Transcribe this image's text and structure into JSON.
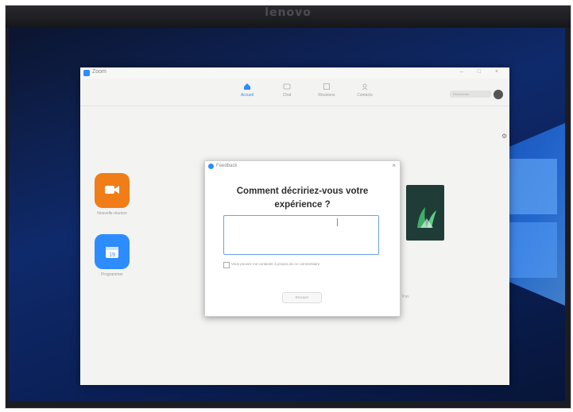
{
  "bezel": {
    "brand": "lenovo"
  },
  "app": {
    "title": "Zoom",
    "nav": {
      "tabs": [
        {
          "label": "Accueil",
          "icon": "home-icon",
          "active": true
        },
        {
          "label": "Chat",
          "icon": "chat-icon",
          "active": false
        },
        {
          "label": "Réunions",
          "icon": "clock-icon",
          "active": false
        },
        {
          "label": "Contacts",
          "icon": "contacts-icon",
          "active": false
        }
      ],
      "search_placeholder": "Rechercher"
    },
    "home": {
      "new_meeting_label": "Nouvelle réunion",
      "schedule_label": "Programmer",
      "schedule_day": "19",
      "side_fragment": "Pas"
    }
  },
  "dialog": {
    "title": "Feedback",
    "close": "×",
    "question_line1": "Comment décririez-vous votre",
    "question_line2": "expérience ?",
    "textarea_value": "",
    "checkbox_label": "Vous pouvez me contacter à propos de ce commentaire",
    "submit_label": "Envoyer"
  },
  "colors": {
    "accent_blue": "#2d8cff",
    "orange": "#f07d18",
    "banner_green": "#1f3d36"
  }
}
